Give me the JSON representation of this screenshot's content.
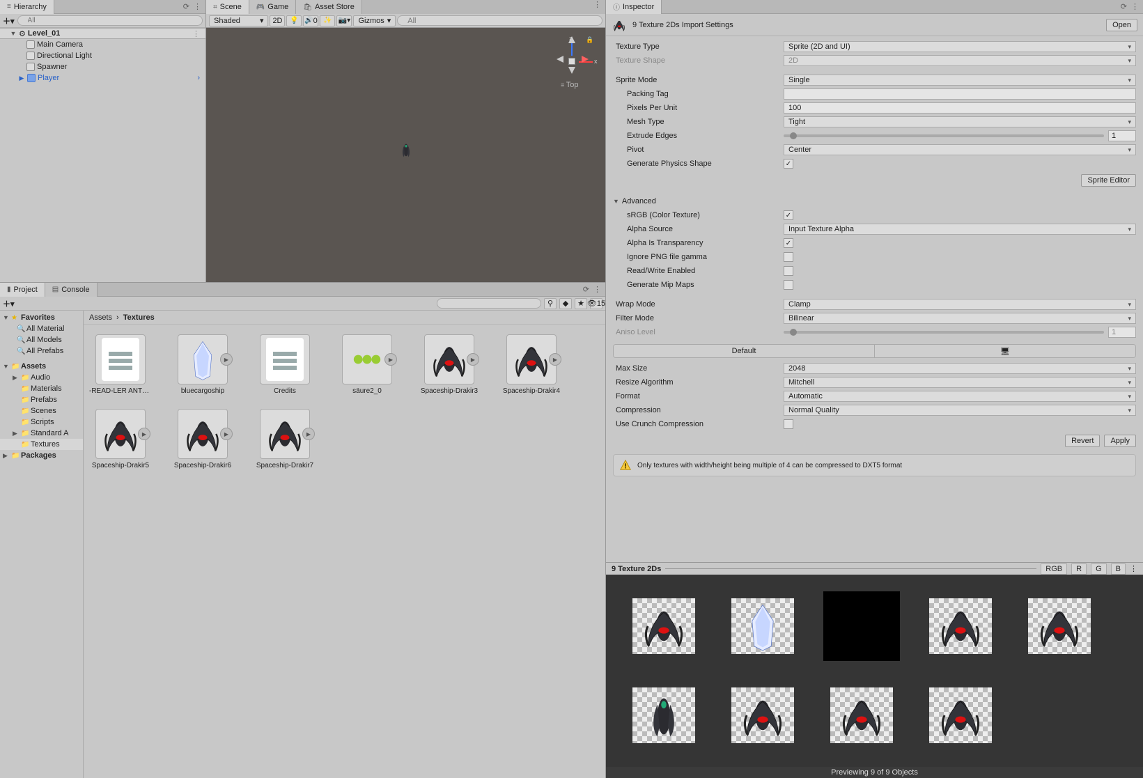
{
  "hierarchy": {
    "tab": "Hierarchy",
    "search_ph": "All",
    "scene": "Level_01",
    "items": [
      "Main Camera",
      "Directional Light",
      "Spawner",
      "Player"
    ]
  },
  "scene": {
    "tabs": [
      "Scene",
      "Game",
      "Asset Store"
    ],
    "shading": "Shaded",
    "mode2d": "2D",
    "audio_count": "0",
    "gizmos": "Gizmos",
    "search_ph": "All",
    "axis_z": "z",
    "axis_x": "x",
    "view": "Top"
  },
  "project": {
    "tabs": [
      "Project",
      "Console"
    ],
    "slider_val": "15",
    "favorites": "Favorites",
    "fav_items": [
      "All Material",
      "All Models",
      "All Prefabs"
    ],
    "assets_root": "Assets",
    "folders": [
      "Audio",
      "Materials",
      "Prefabs",
      "Scenes",
      "Scripts",
      "Standard A",
      "Textures"
    ],
    "packages": "Packages",
    "breadcrumb": [
      "Assets",
      "Textures"
    ],
    "assets": [
      {
        "name": "-READ-LER ANTE...",
        "type": "doc"
      },
      {
        "name": "bluecargoship",
        "type": "sprite"
      },
      {
        "name": "Credits",
        "type": "doc"
      },
      {
        "name": "säure2_0",
        "type": "sprite"
      },
      {
        "name": "Spaceship-Drakir3",
        "type": "sprite"
      },
      {
        "name": "Spaceship-Drakir4",
        "type": "sprite"
      },
      {
        "name": "Spaceship-Drakir5",
        "type": "sprite"
      },
      {
        "name": "Spaceship-Drakir6",
        "type": "sprite"
      },
      {
        "name": "Spaceship-Drakir7",
        "type": "sprite"
      }
    ]
  },
  "inspector": {
    "tab": "Inspector",
    "title": "9 Texture 2Ds Import Settings",
    "open": "Open",
    "texture_type": {
      "label": "Texture Type",
      "value": "Sprite (2D and UI)"
    },
    "texture_shape": {
      "label": "Texture Shape",
      "value": "2D"
    },
    "sprite_mode": {
      "label": "Sprite Mode",
      "value": "Single"
    },
    "packing_tag": {
      "label": "Packing Tag",
      "value": ""
    },
    "ppu": {
      "label": "Pixels Per Unit",
      "value": "100"
    },
    "mesh_type": {
      "label": "Mesh Type",
      "value": "Tight"
    },
    "extrude": {
      "label": "Extrude Edges",
      "value": "1"
    },
    "pivot": {
      "label": "Pivot",
      "value": "Center"
    },
    "gen_phys": {
      "label": "Generate Physics Shape",
      "checked": true
    },
    "sprite_editor": "Sprite Editor",
    "advanced": "Advanced",
    "srgb": {
      "label": "sRGB (Color Texture)",
      "checked": true
    },
    "alpha_source": {
      "label": "Alpha Source",
      "value": "Input Texture Alpha"
    },
    "alpha_trans": {
      "label": "Alpha Is Transparency",
      "checked": true
    },
    "ignore_png": {
      "label": "Ignore PNG file gamma",
      "checked": false
    },
    "rw": {
      "label": "Read/Write Enabled",
      "checked": false
    },
    "mipmaps": {
      "label": "Generate Mip Maps",
      "checked": false
    },
    "wrap": {
      "label": "Wrap Mode",
      "value": "Clamp"
    },
    "filter": {
      "label": "Filter Mode",
      "value": "Bilinear"
    },
    "aniso": {
      "label": "Aniso Level",
      "value": "1"
    },
    "platform_default": "Default",
    "max_size": {
      "label": "Max Size",
      "value": "2048"
    },
    "resize": {
      "label": "Resize Algorithm",
      "value": "Mitchell"
    },
    "format": {
      "label": "Format",
      "value": "Automatic"
    },
    "compression": {
      "label": "Compression",
      "value": "Normal Quality"
    },
    "crunch": {
      "label": "Use Crunch Compression",
      "checked": false
    },
    "revert": "Revert",
    "apply": "Apply",
    "warn": "Only textures with width/height being multiple of 4 can be compressed to DXT5 format"
  },
  "preview": {
    "title": "9 Texture 2Ds",
    "channels": [
      "RGB",
      "R",
      "G",
      "B"
    ],
    "footer": "Previewing 9 of 9 Objects"
  }
}
